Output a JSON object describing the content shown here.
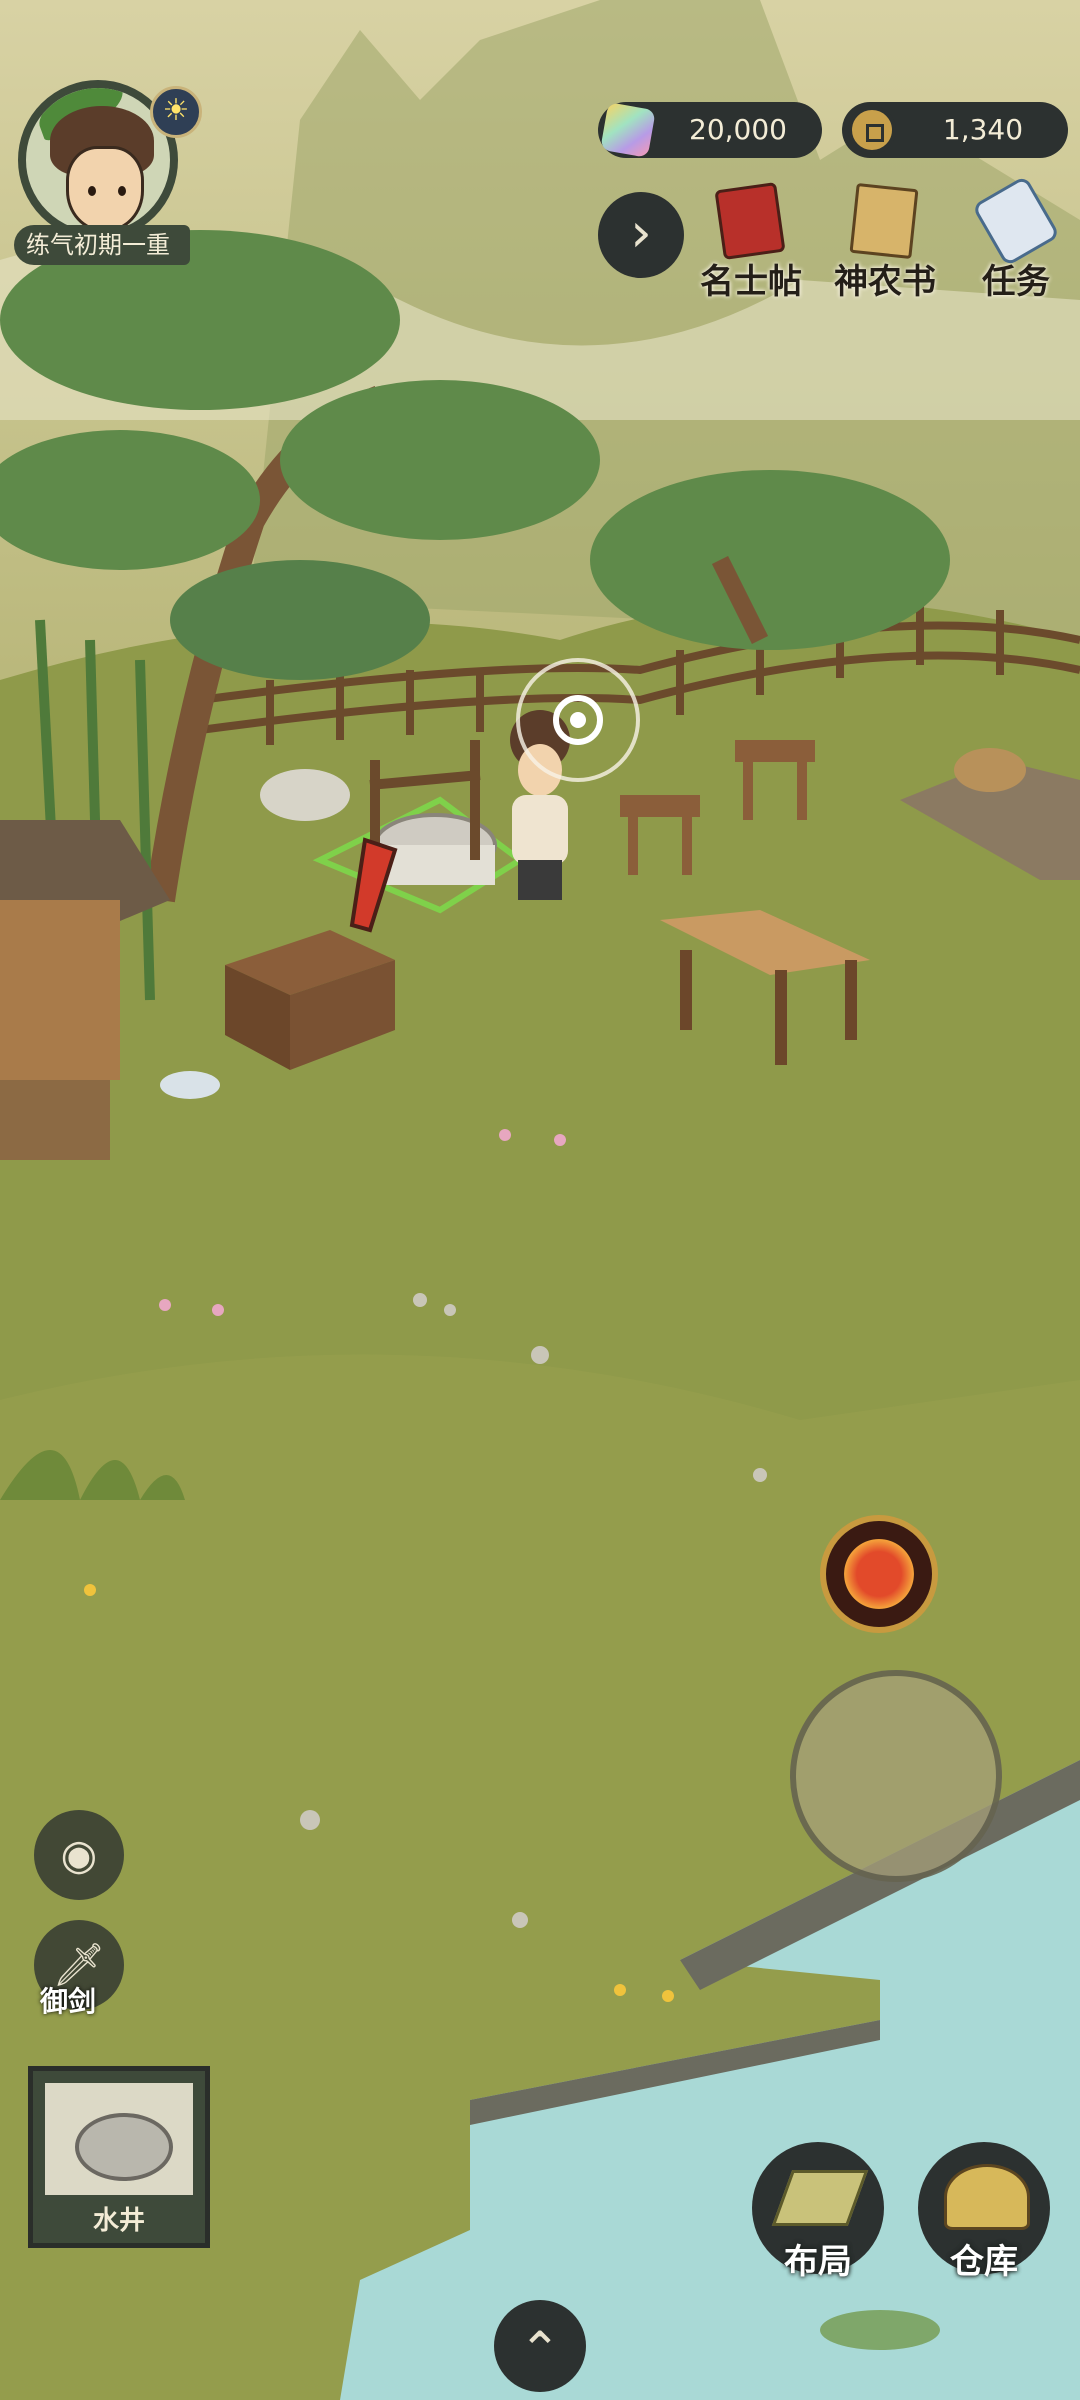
{
  "player": {
    "rank": "练气初期一重",
    "avatar_icon": "player-portrait",
    "weather_icon": "sun-icon"
  },
  "currency": {
    "crystal": {
      "icon": "crystal-icon",
      "value": "20,000"
    },
    "coin": {
      "icon": "copper-coin-icon",
      "value": "1,340"
    }
  },
  "top_menu": {
    "expand_icon": "chevron-right-icon",
    "items": [
      {
        "label": "名士帖",
        "icon": "invitation-icon"
      },
      {
        "label": "神农书",
        "icon": "book-icon"
      },
      {
        "label": "任务",
        "icon": "scroll-icon"
      }
    ]
  },
  "left_controls": {
    "hide_ui_icon": "eye-icon",
    "sword_label": "御剑",
    "sword_icon": "sword-icon"
  },
  "selected_building": {
    "label": "水井",
    "icon": "well-icon"
  },
  "bottom_menu": {
    "layout_label": "布局",
    "warehouse_label": "仓库",
    "collapse_icon": "chevron-up-icon"
  },
  "skill": {
    "icon": "fire-spirit-icon"
  },
  "colors": {
    "grass": "#8f9a4a",
    "hud_dark": "#2c3130",
    "water": "#a9d9d6",
    "paper_sky": "#d9d3a8"
  }
}
